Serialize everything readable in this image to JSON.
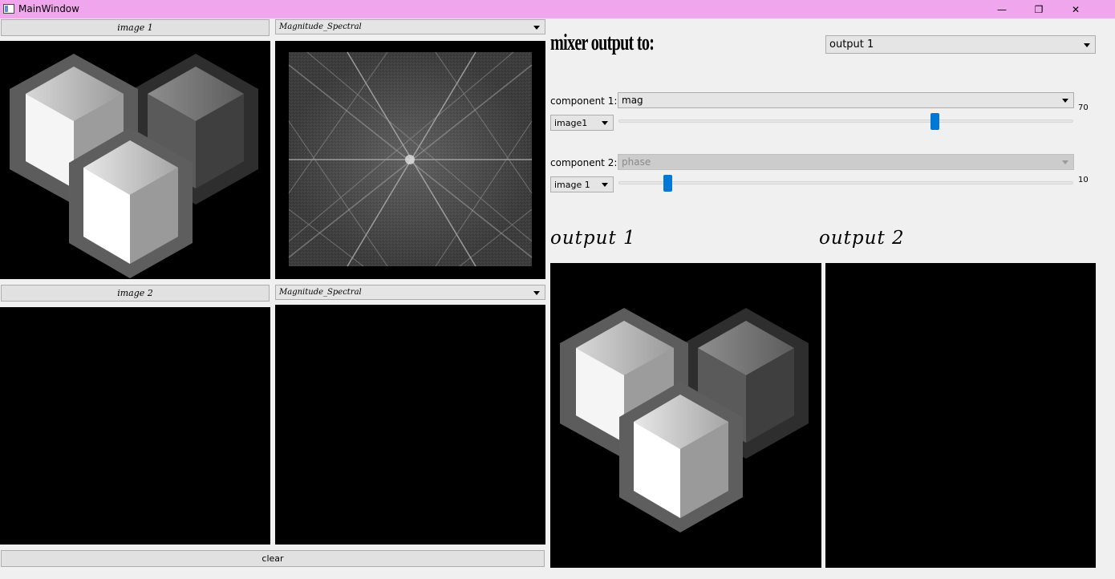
{
  "window": {
    "title": "MainWindow",
    "minimize_glyph": "—",
    "maximize_glyph": "❐",
    "close_glyph": "✕"
  },
  "inputs": {
    "image1_button": "image 1",
    "image1_component": "Magnitude_Spectral",
    "image2_button": "image 2",
    "image2_component": "Magnitude_Spectral",
    "clear_label": "clear"
  },
  "mixer": {
    "title": "mixer output to:",
    "output_select": "output 1",
    "component1": {
      "label": "component 1:",
      "type": "mag",
      "image": "image1",
      "slider_value": "70",
      "slider_fraction": 0.7
    },
    "component2": {
      "label": "component 2:",
      "type": "phase",
      "image": "image 1",
      "slider_value": "10",
      "slider_fraction": 0.1
    }
  },
  "outputs": {
    "output1_title": "output 1",
    "output2_title": "output 2"
  },
  "icons": [
    "app-icon",
    "minimize-icon",
    "maximize-icon",
    "close-icon",
    "chevron-down-icon"
  ],
  "colors": {
    "titlebar": "#f0a6ec",
    "slider_handle": "#0078d7",
    "panel_background": "#000000"
  }
}
